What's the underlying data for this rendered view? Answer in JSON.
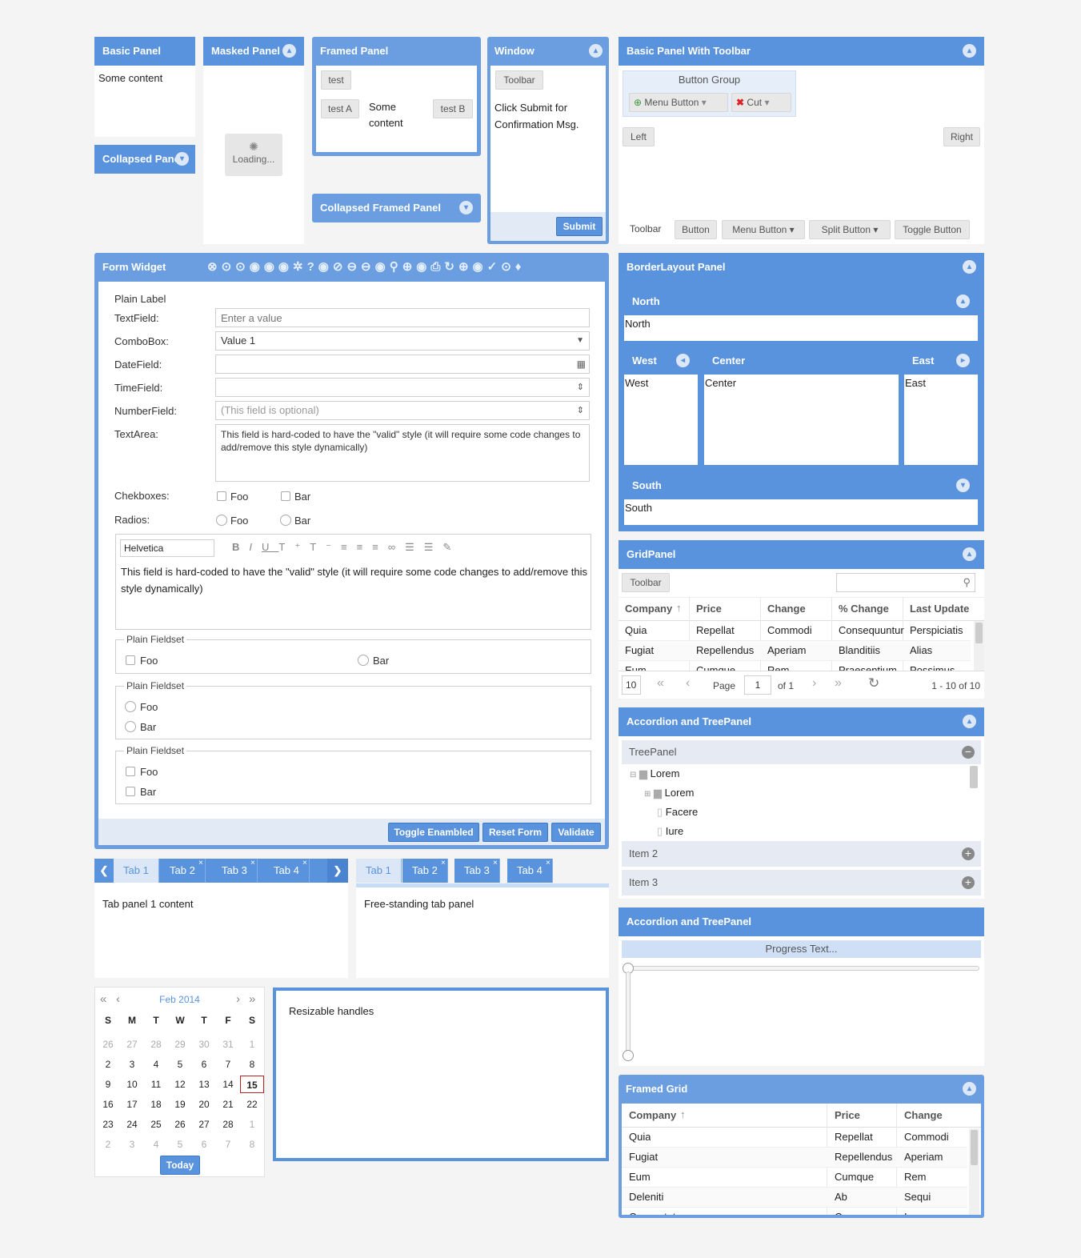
{
  "basic_panel": {
    "title": "Basic Panel",
    "content": "Some content"
  },
  "collapsed_panel": {
    "title": "Collapsed Panel"
  },
  "masked_panel": {
    "title": "Masked Panel",
    "loading": "Loading..."
  },
  "framed_panel": {
    "title": "Framed Panel",
    "test": "test",
    "testA": "test A",
    "content": "Some content",
    "testB": "test B"
  },
  "collapsed_framed": {
    "title": "Collapsed Framed Panel"
  },
  "window": {
    "title": "Window",
    "toolbar": "Toolbar",
    "content": "Click Submit for Confirmation Msg.",
    "submit": "Submit"
  },
  "toolbar_panel": {
    "title": "Basic Panel With Toolbar",
    "group": "Button Group",
    "menu_button": "Menu Button",
    "cut": "Cut",
    "left": "Left",
    "right": "Right",
    "tb_label": "Toolbar",
    "button": "Button",
    "menu_btn2": "Menu Button",
    "split": "Split Button",
    "toggle": "Toggle Button"
  },
  "form": {
    "title": "Form Widget",
    "plain_label": "Plain Label",
    "text_label": "TextField:",
    "text_ph": "Enter a value",
    "combo_label": "ComboBox:",
    "combo_val": "Value 1",
    "date_label": "DateField:",
    "time_label": "TimeField:",
    "num_label": "NumberField:",
    "num_ph": "(This field is optional)",
    "ta_label": "TextArea:",
    "ta_val": "This field is hard-coded to have the \"valid\" style (it will require some code changes to add/remove this style dynamically)",
    "cb_label": "Chekboxes:",
    "foo": "Foo",
    "bar": "Bar",
    "radio_label": "Radios:",
    "font": "Helvetica",
    "editor_val": "This field is hard-coded to have the \"valid\" style (it will require some code changes to add/remove this style dynamically)",
    "fieldset": "Plain Fieldset",
    "toggle": "Toggle Enambled",
    "reset": "Reset Form",
    "validate": "Validate"
  },
  "tabs1": {
    "tabs": [
      "Tab 1",
      "Tab 2",
      "Tab 3",
      "Tab 4"
    ],
    "content": "Tab panel 1 content"
  },
  "tabs2": {
    "tabs": [
      "Tab 1",
      "Tab 2",
      "Tab 3",
      "Tab 4"
    ],
    "content": "Free-standing tab panel"
  },
  "calendar": {
    "month": "Feb 2014",
    "days": [
      "S",
      "M",
      "T",
      "W",
      "T",
      "F",
      "S"
    ],
    "weeks": [
      [
        "26",
        "27",
        "28",
        "29",
        "30",
        "31",
        "1"
      ],
      [
        "2",
        "3",
        "4",
        "5",
        "6",
        "7",
        "8"
      ],
      [
        "9",
        "10",
        "11",
        "12",
        "13",
        "14",
        "15"
      ],
      [
        "16",
        "17",
        "18",
        "19",
        "20",
        "21",
        "22"
      ],
      [
        "23",
        "24",
        "25",
        "26",
        "27",
        "28",
        "1"
      ],
      [
        "2",
        "3",
        "4",
        "5",
        "6",
        "7",
        "8"
      ]
    ],
    "today": "Today"
  },
  "resizable": {
    "content": "Resizable handles"
  },
  "border": {
    "title": "BorderLayout Panel",
    "north": "North",
    "west": "West",
    "center": "Center",
    "east": "East",
    "south": "South"
  },
  "grid": {
    "title": "GridPanel",
    "toolbar": "Toolbar",
    "cols": [
      "Company",
      "Price",
      "Change",
      "% Change",
      "Last Update"
    ],
    "rows": [
      [
        "Quia",
        "Repellat",
        "Commodi",
        "Consequuntur",
        "Perspiciatis"
      ],
      [
        "Fugiat",
        "Repellendus",
        "Aperiam",
        "Blanditiis",
        "Alias"
      ],
      [
        "Eum",
        "Cumque",
        "Rem",
        "Praesentium",
        "Possimus"
      ]
    ],
    "page_size": "10",
    "page": "Page",
    "page_num": "1",
    "of": "of 1",
    "range": "1 - 10 of 10"
  },
  "accordion": {
    "title": "Accordion and TreePanel",
    "tree": "TreePanel",
    "nodes": [
      "Lorem",
      "Lorem",
      "Facere",
      "Iure"
    ],
    "item2": "Item 2",
    "item3": "Item 3"
  },
  "progress": {
    "title": "Accordion and TreePanel",
    "text": "Progress Text..."
  },
  "framed_grid": {
    "title": "Framed Grid",
    "cols": [
      "Company",
      "Price",
      "Change"
    ],
    "rows": [
      [
        "Quia",
        "Repellat",
        "Commodi"
      ],
      [
        "Fugiat",
        "Repellendus",
        "Aperiam"
      ],
      [
        "Eum",
        "Cumque",
        "Rem"
      ],
      [
        "Deleniti",
        "Ab",
        "Sequi"
      ],
      [
        "Consectetur",
        "Cumque",
        "Iure"
      ]
    ]
  },
  "colors": {
    "accent": "#5a93dd"
  }
}
